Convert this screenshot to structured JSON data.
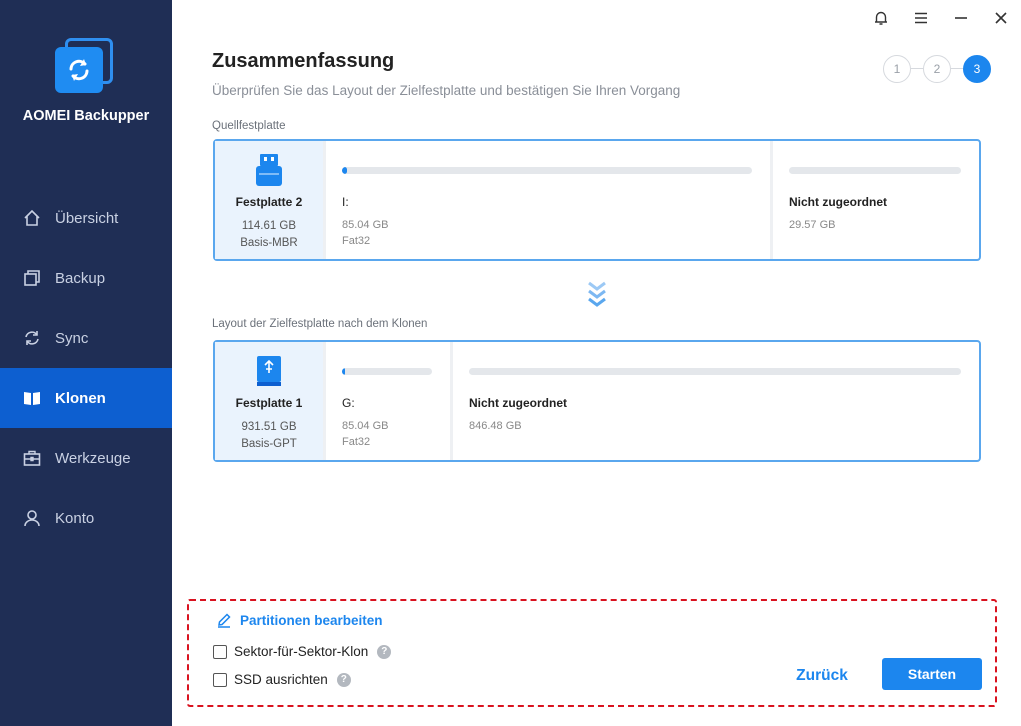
{
  "app": {
    "title": "AOMEI Backupper"
  },
  "sidebar": {
    "items": [
      {
        "label": "Übersicht",
        "icon": "home-icon",
        "active": false
      },
      {
        "label": "Backup",
        "icon": "backup-icon",
        "active": false
      },
      {
        "label": "Sync",
        "icon": "sync-icon",
        "active": false
      },
      {
        "label": "Klonen",
        "icon": "clone-icon",
        "active": true
      },
      {
        "label": "Werkzeuge",
        "icon": "tools-icon",
        "active": false
      },
      {
        "label": "Konto",
        "icon": "user-icon",
        "active": false
      }
    ]
  },
  "titlebar": {
    "icons": [
      "bell-icon",
      "menu-icon",
      "minimize-icon",
      "close-icon"
    ]
  },
  "header": {
    "title": "Zusammenfassung",
    "subtitle": "Überprüfen Sie das Layout der Zielfestplatte und bestätigen Sie Ihren Vorgang"
  },
  "steps": [
    "1",
    "2",
    "3"
  ],
  "active_step": 3,
  "source": {
    "label": "Quellfestplatte",
    "disk": {
      "name": "Festplatte 2",
      "size": "114.61 GB",
      "type": "Basis-MBR"
    },
    "partitions": [
      {
        "label": "I:",
        "size": "85.04 GB",
        "fs": "Fat32",
        "used": 0.01
      },
      {
        "label": "Nicht zugeordnet",
        "size": "29.57 GB",
        "fs": "",
        "used": 0
      }
    ]
  },
  "target": {
    "label": "Layout der Zielfestplatte nach dem Klonen",
    "disk": {
      "name": "Festplatte 1",
      "size": "931.51 GB",
      "type": "Basis-GPT"
    },
    "partitions": [
      {
        "label": "G:",
        "size": "85.04 GB",
        "fs": "Fat32",
        "used": 0.03
      },
      {
        "label": "Nicht zugeordnet",
        "size": "846.48 GB",
        "fs": "",
        "used": 0
      }
    ]
  },
  "footer": {
    "edit_partitions": "Partitionen bearbeiten",
    "sector_clone": "Sektor-für-Sektor-Klon",
    "ssd_align": "SSD ausrichten",
    "back_button": "Zurück",
    "start_button": "Starten"
  },
  "colors": {
    "accent": "#1c86ee",
    "sidebar": "#1f2e55",
    "highlight_border": "#d9121f"
  }
}
